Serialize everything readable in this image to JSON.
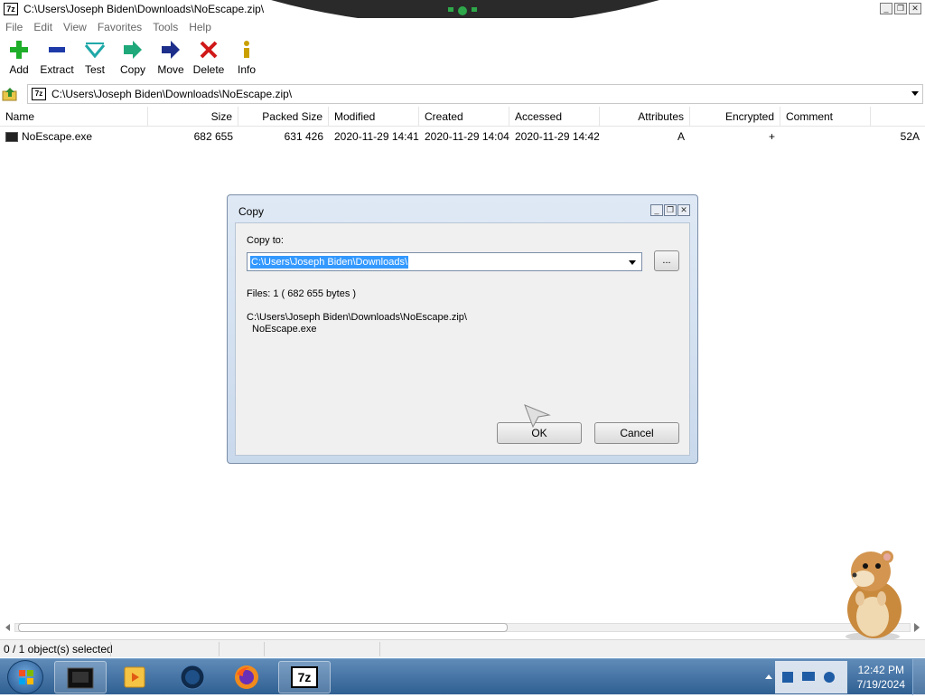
{
  "window": {
    "title": "C:\\Users\\Joseph Biden\\Downloads\\NoEscape.zip\\",
    "icon_text": "7z"
  },
  "menu": [
    "File",
    "Edit",
    "View",
    "Favorites",
    "Tools",
    "Help"
  ],
  "toolbar": [
    {
      "label": "Add",
      "icon": "plus-icon"
    },
    {
      "label": "Extract",
      "icon": "minus-icon"
    },
    {
      "label": "Test",
      "icon": "check-icon"
    },
    {
      "label": "Copy",
      "icon": "double-arrow-icon"
    },
    {
      "label": "Move",
      "icon": "arrow-right-icon"
    },
    {
      "label": "Delete",
      "icon": "x-icon"
    },
    {
      "label": "Info",
      "icon": "info-icon"
    }
  ],
  "address": {
    "path": "C:\\Users\\Joseph Biden\\Downloads\\NoEscape.zip\\"
  },
  "columns": [
    "Name",
    "Size",
    "Packed Size",
    "Modified",
    "Created",
    "Accessed",
    "Attributes",
    "Encrypted",
    "Comment"
  ],
  "files": [
    {
      "name": "NoEscape.exe",
      "size": "682 655",
      "packed": "631 426",
      "modified": "2020-11-29 14:41",
      "created": "2020-11-29 14:04",
      "accessed": "2020-11-29 14:42",
      "attributes": "A",
      "encrypted": "+",
      "comment": "",
      "extra": "52A"
    }
  ],
  "status": {
    "selected": "0 / 1 object(s) selected"
  },
  "dialog": {
    "title": "Copy",
    "copy_to_label": "Copy to:",
    "copy_to_value": "C:\\Users\\Joseph Biden\\Downloads\\",
    "browse_label": "...",
    "files_info": "Files: 1    ( 682 655 bytes )",
    "path_line1": "C:\\Users\\Joseph Biden\\Downloads\\NoEscape.zip\\",
    "path_line2": "NoEscape.exe",
    "ok_label": "OK",
    "cancel_label": "Cancel"
  },
  "taskbar": {
    "time": "12:42 PM",
    "date": "7/19/2024",
    "items": [
      "terminal-app-icon",
      "media-player-icon",
      "globe-app-icon",
      "firefox-icon",
      "7zip-icon"
    ],
    "active_item_label": "7z"
  },
  "colors": {
    "selection": "#3399ff",
    "taskbar": "#3e6ea2"
  }
}
